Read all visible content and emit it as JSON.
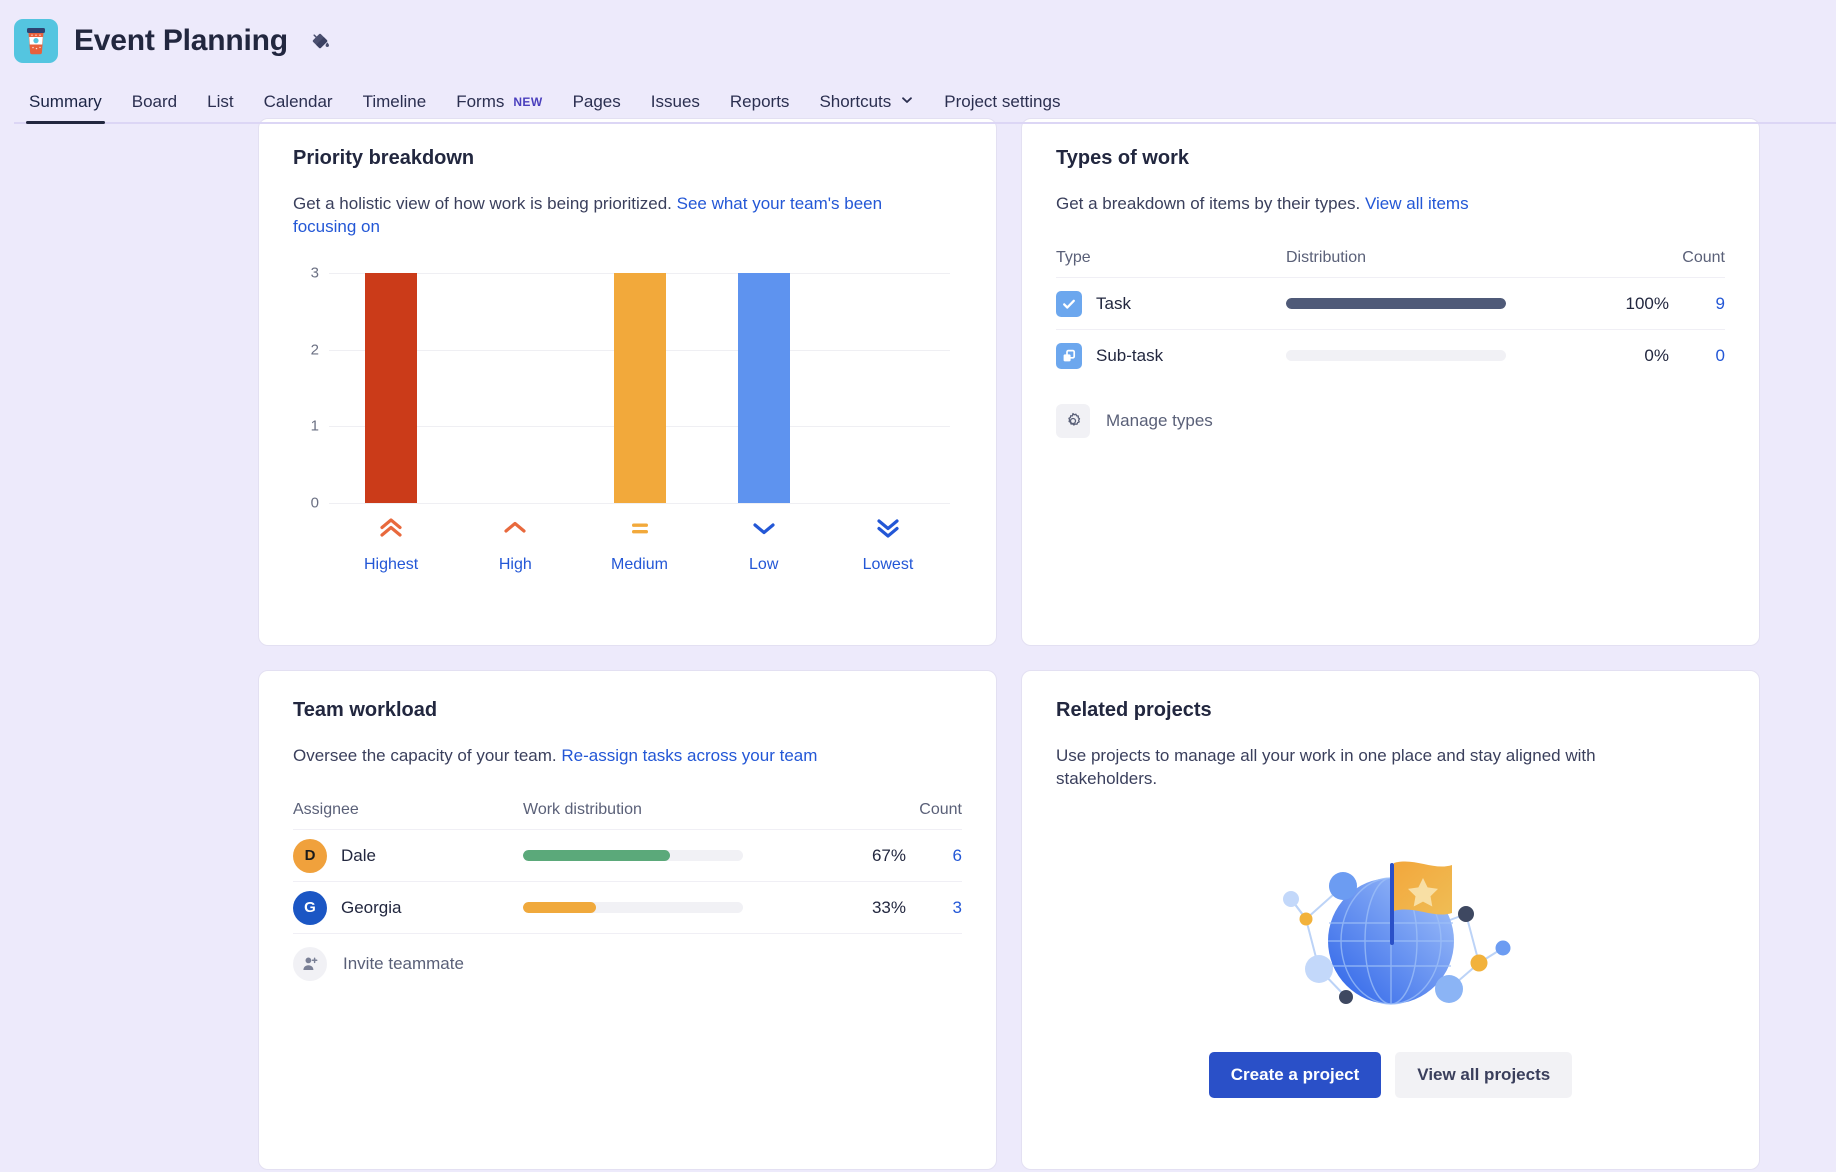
{
  "header": {
    "project_icon": "coffee-cup-icon",
    "title": "Event Planning",
    "edit_icon": "paint-fill-icon",
    "nav": [
      {
        "label": "Summary",
        "active": true
      },
      {
        "label": "Board",
        "active": false
      },
      {
        "label": "List",
        "active": false
      },
      {
        "label": "Calendar",
        "active": false
      },
      {
        "label": "Timeline",
        "active": false
      },
      {
        "label": "Forms",
        "active": false,
        "badge": "NEW"
      },
      {
        "label": "Pages",
        "active": false
      },
      {
        "label": "Issues",
        "active": false
      },
      {
        "label": "Reports",
        "active": false
      },
      {
        "label": "Shortcuts",
        "active": false,
        "chevron": true
      },
      {
        "label": "Project settings",
        "active": false
      }
    ]
  },
  "priority_card": {
    "title": "Priority breakdown",
    "desc_plain": "Get a holistic view of how work is being prioritized. ",
    "desc_link": "See what your team's been focusing on"
  },
  "chart_data": {
    "type": "bar",
    "title": "Priority breakdown",
    "categories": [
      "Highest",
      "High",
      "Medium",
      "Low",
      "Lowest"
    ],
    "values": [
      3,
      0,
      3,
      3,
      0
    ],
    "colors": [
      "#CB3B19",
      "#CB3B19",
      "#F2A93B",
      "#5E93EF",
      "#5E93EF"
    ],
    "icons": [
      "double-chevron-up-icon",
      "chevron-up-icon",
      "equals-icon",
      "chevron-down-icon",
      "double-chevron-down-icon"
    ],
    "icon_colors": [
      "#E8693D",
      "#E8693D",
      "#F2A93B",
      "#2357D6",
      "#2357D6"
    ],
    "xlabel": "",
    "ylabel": "",
    "ylim": [
      0,
      3
    ],
    "yticks": [
      3,
      2,
      1,
      0
    ],
    "grid": true,
    "legend": "none"
  },
  "types_card": {
    "title": "Types of work",
    "desc_plain": "Get a breakdown of items by their types. ",
    "desc_link": "View all items",
    "columns": {
      "type": "Type",
      "distribution": "Distribution",
      "count": "Count"
    },
    "rows": [
      {
        "icon": "task-check-icon",
        "icon_bg": "#6CA7EE",
        "label": "Task",
        "percent": 100,
        "percent_text": "100%",
        "count": "9",
        "fill_color": "#4F5A78"
      },
      {
        "icon": "subtask-icon",
        "icon_bg": "#6CA7EE",
        "label": "Sub-task",
        "percent": 0,
        "percent_text": "0%",
        "count": "0",
        "fill_color": "#4F5A78"
      }
    ],
    "manage": {
      "icon": "gear-icon",
      "label": "Manage types"
    }
  },
  "workload_card": {
    "title": "Team workload",
    "desc_plain": "Oversee the capacity of your team. ",
    "desc_link": "Re-assign tasks across your team",
    "columns": {
      "assignee": "Assignee",
      "distribution": "Work distribution",
      "count": "Count"
    },
    "rows": [
      {
        "initial": "D",
        "avatar_bg": "#F0A13C",
        "avatar_fg": "#1B1B1B",
        "name": "Dale",
        "percent": 67,
        "percent_text": "67%",
        "count": "6",
        "fill_color": "#5BA97A"
      },
      {
        "initial": "G",
        "avatar_bg": "#1B56C4",
        "avatar_fg": "#FFFFFF",
        "name": "Georgia",
        "percent": 33,
        "percent_text": "33%",
        "count": "3",
        "fill_color": "#F0A93C"
      }
    ],
    "invite": {
      "icon": "person-add-icon",
      "label": "Invite teammate"
    }
  },
  "related_card": {
    "title": "Related projects",
    "desc": "Use projects to manage all your work in one place and stay aligned with stakeholders.",
    "illustration": "globe-flag-network-illustration",
    "primary_button": "Create a project",
    "secondary_button": "View all projects"
  },
  "colors": {
    "page_bg": "#EDEAFB",
    "card_bg": "#FFFFFF",
    "accent_link": "#2357D6",
    "primary_button": "#2A50C8",
    "text": "#22273F"
  }
}
